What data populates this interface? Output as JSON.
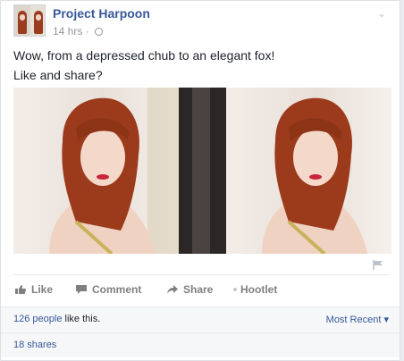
{
  "post": {
    "page_name": "Project Harpoon",
    "timestamp": "14 hrs",
    "separator": "·",
    "privacy_icon": "globe-icon",
    "menu_icon": "chevron-down-icon",
    "text_line1": "Wow, from a depressed chub to an elegant fox!",
    "text_line2": "Like and share?"
  },
  "actions": {
    "like": "Like",
    "comment": "Comment",
    "share": "Share",
    "hootlet": "Hootlet"
  },
  "stats": {
    "likes_count": "126 people",
    "likes_suffix": " like this.",
    "sort_label": "Most Recent",
    "sort_arrow": "▾",
    "shares": "18 shares"
  },
  "colors": {
    "link": "#365899",
    "muted": "#90949c",
    "action": "#7f7f7f"
  }
}
